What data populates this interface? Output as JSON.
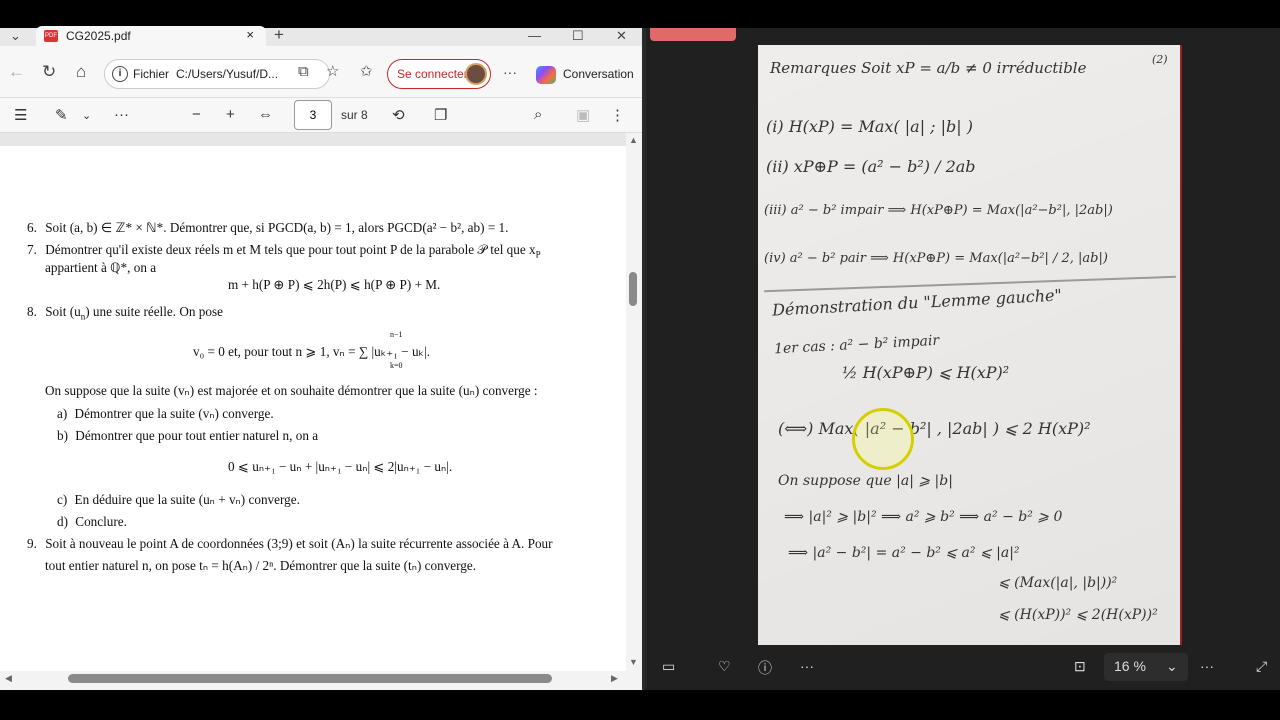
{
  "browser": {
    "tab_title": "CG2025.pdf",
    "tab_close": "×",
    "new_tab": "+",
    "url_label": "Fichier",
    "url_path": "C:/Users/Yusuf/D...",
    "connect_label": "Se connecter",
    "copilot_label": "Conversation"
  },
  "pdf_toolbar": {
    "current_page": "3",
    "total_pages": "sur 8"
  },
  "document": {
    "items": [
      {
        "num": "6.",
        "text": "Soit (a, b) ∈ ℤ* × ℕ*. Démontrer que, si PGCD(a, b) = 1, alors PGCD(a² − b², ab) = 1."
      },
      {
        "num": "7.",
        "text": "Démontrer qu'il existe deux réels m et M tels que pour tout point P de la parabole 𝒫 tel que x",
        "sub": "P"
      },
      {
        "cont": "appartient à ℚ*, on a"
      },
      {
        "eq": "m + h(P ⊕ P) ⩽ 2h(P) ⩽ h(P ⊕ P) + M."
      },
      {
        "num": "8.",
        "text": "Soit (u",
        "sub": "n",
        "text2": ") une suite réelle. On pose"
      },
      {
        "eq": "v₀ = 0    et, pour tout n ⩾ 1,    vₙ = ∑ |uₖ₊₁ − uₖ|."
      },
      {
        "cont": "On suppose que la suite (vₙ) est majorée et on souhaite démontrer que la suite (uₙ) converge :"
      },
      {
        "sub_item": "a)",
        "text": "Démontrer que la suite (vₙ) converge."
      },
      {
        "sub_item": "b)",
        "text": "Démontrer que pour tout entier naturel n, on a"
      },
      {
        "eq": "0 ⩽ uₙ₊₁ − uₙ + |uₙ₊₁ − uₙ| ⩽ 2|uₙ₊₁ − uₙ|."
      },
      {
        "sub_item": "c)",
        "text": "En déduire que la suite (uₙ + vₙ) converge."
      },
      {
        "sub_item": "d)",
        "text": "Conclure."
      },
      {
        "num": "9.",
        "text": "Soit à nouveau le point A de coordonnées (3;9) et soit (Aₙ) la suite récurrente associée à A. Pour"
      },
      {
        "cont": "tout entier naturel n, on pose tₙ = h(Aₙ) / 2ⁿ. Démontrer que la suite (tₙ) converge."
      }
    ],
    "sum_top": "n−1",
    "sum_bottom": "k=0"
  },
  "notes": {
    "line1": "Remarques   Soit  xP = a/b ≠ 0  irréductible",
    "corner": "(2)",
    "line2": "(i)   H(xP) = Max( |a| ; |b| )",
    "line3": "(ii)   xP⊕P = (a² − b²) / 2ab",
    "line4": "(iii)   a² − b² impair ⟹ H(xP⊕P) = Max(|a²−b²|, |2ab|)",
    "line5": "(iv)   a² − b² pair ⟹ H(xP⊕P) = Max(|a²−b²| / 2, |ab|)",
    "line6": "Démonstration du \"Lemme gauche\"",
    "line7": "1er cas : a² − b² impair",
    "line8": "½ H(xP⊕P) ⩽ H(xP)²",
    "line9": "(⟺) Max( |a² − b²| , |2ab| ) ⩽ 2 H(xP)²",
    "line10": "On suppose que |a| ⩾ |b|",
    "line11": "⟹ |a|² ⩾ |b|²  ⟹  a² ⩾ b²  ⟹  a² − b² ⩾ 0",
    "line12": "⟹ |a² − b²| = a² − b² ⩽ a² ⩽ |a|²",
    "line13": "⩽ (Max(|a|, |b|))²",
    "line14": "⩽ (H(xP))² ⩽ 2(H(xP))²"
  },
  "viewer": {
    "zoom": "16 %"
  }
}
